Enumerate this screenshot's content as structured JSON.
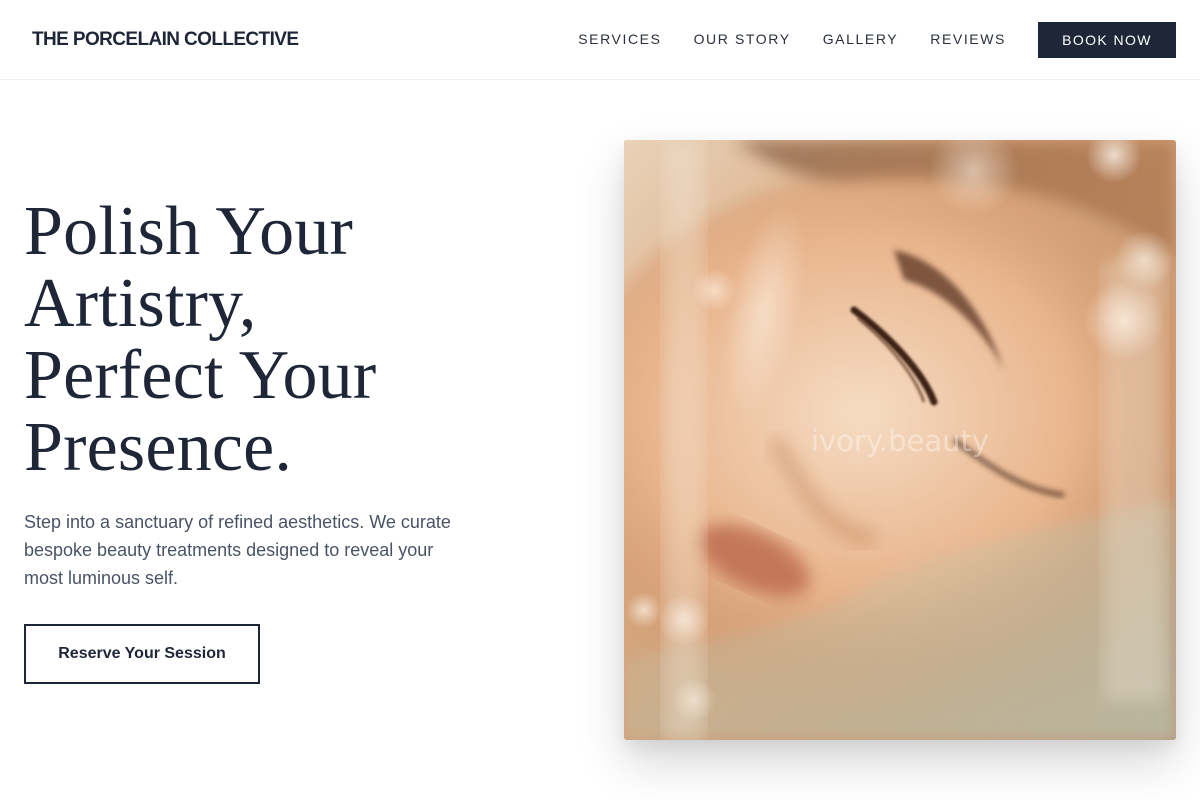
{
  "header": {
    "brand": "THE PORCELAIN COLLECTIVE",
    "nav": [
      {
        "label": "SERVICES"
      },
      {
        "label": "OUR STORY"
      },
      {
        "label": "GALLERY"
      },
      {
        "label": "REVIEWS"
      }
    ],
    "book_label": "BOOK NOW"
  },
  "hero": {
    "title_lines": [
      "Polish Your",
      "Artistry,",
      "Perfect Your",
      "Presence."
    ],
    "subtitle": "Step into a sanctuary of refined aesthetics. We curate bespoke beauty treatments designed to reveal your most luminous self.",
    "cta_label": "Reserve Your Session",
    "image": {
      "watermark": "ivory.beauty"
    }
  },
  "colors": {
    "primary_navy": "#1e2637",
    "body_text": "#4a5365",
    "background": "#ffffff",
    "image_warm_tone": "#c9a27f"
  }
}
